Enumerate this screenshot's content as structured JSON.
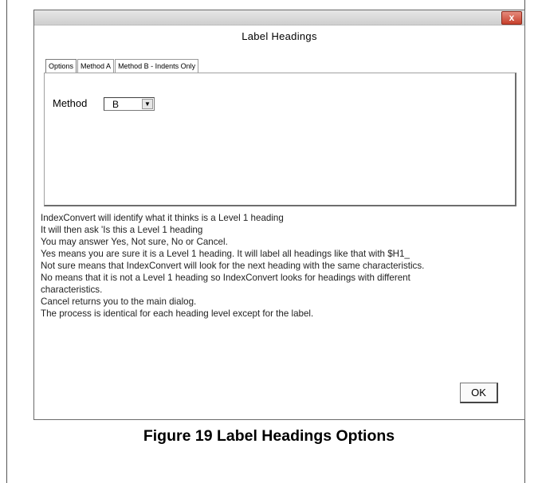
{
  "dialog": {
    "close_symbol": "x",
    "title": "Label Headings",
    "tabs": [
      {
        "label": "Options",
        "active": true
      },
      {
        "label": "Method A",
        "active": false
      },
      {
        "label": "Method B - Indents Only",
        "active": false
      }
    ],
    "method": {
      "label": "Method",
      "selected": "B",
      "arrow_glyph": "▼"
    },
    "help_lines": [
      "IndexConvert will identify what it thinks is a Level 1 heading",
      "It will then ask 'Is this a Level 1 heading",
      "You may answer Yes, Not sure, No or Cancel.",
      "Yes means you are sure it is a Level 1 heading.  It will label all headings like that with $H1_",
      "Not sure means that IndexConvert will look for the next heading with the same characteristics.",
      "No means that it is not a Level 1 heading so IndexConvert looks for headings with different",
      "characteristics.",
      "Cancel returns you to the main dialog.",
      "The process is identical for each heading level except for the label."
    ],
    "ok_label": "OK"
  },
  "caption": "Figure 19 Label Headings Options"
}
